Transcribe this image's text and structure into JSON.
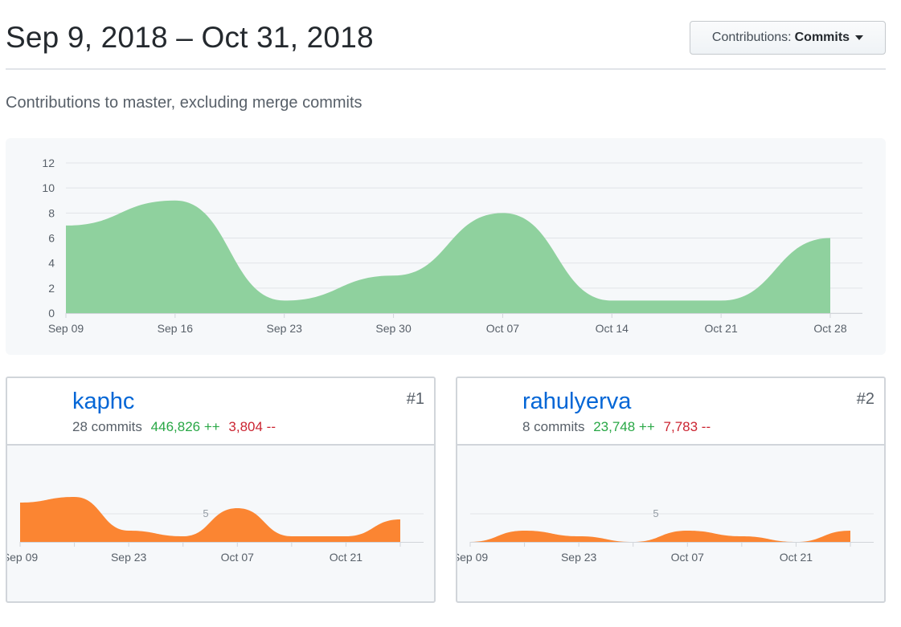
{
  "header": {
    "date_range": "Sep 9, 2018 – Oct 31, 2018",
    "dropdown_prefix": "Contributions:",
    "dropdown_value": "Commits"
  },
  "subtitle": "Contributions to master, excluding merge commits",
  "colors": {
    "main_area": "#8fd19e",
    "contributor_area": "#fb8532",
    "link": "#0366d6",
    "additions": "#28a745",
    "deletions": "#cb2431"
  },
  "chart_data": [
    {
      "type": "area",
      "title": "",
      "xlabel": "",
      "ylabel": "",
      "x_ticks": [
        "Sep 09",
        "Sep 16",
        "Sep 23",
        "Sep 30",
        "Oct 07",
        "Oct 14",
        "Oct 21",
        "Oct 28"
      ],
      "y_ticks": [
        0,
        2,
        4,
        6,
        8,
        10,
        12
      ],
      "ylim": [
        0,
        12
      ],
      "grid": true,
      "x": [
        "2018-09-09",
        "2018-09-16",
        "2018-09-23",
        "2018-09-30",
        "2018-10-07",
        "2018-10-14",
        "2018-10-21",
        "2018-10-28"
      ],
      "series": [
        {
          "values": [
            7,
            9,
            1,
            3,
            8,
            1,
            1,
            6
          ]
        }
      ]
    },
    {
      "type": "area",
      "contributor": "kaphc",
      "x_ticks": [
        "Sep 09",
        "Sep 23",
        "Oct 07",
        "Oct 21"
      ],
      "y_ticks": [
        5
      ],
      "ylim": [
        0,
        9
      ],
      "x": [
        "2018-09-09",
        "2018-09-16",
        "2018-09-23",
        "2018-09-30",
        "2018-10-07",
        "2018-10-14",
        "2018-10-21",
        "2018-10-28"
      ],
      "series": [
        {
          "values": [
            7,
            8,
            2,
            1,
            6,
            1,
            1,
            4
          ]
        }
      ]
    },
    {
      "type": "area",
      "contributor": "rahulyerva",
      "x_ticks": [
        "Sep 09",
        "Sep 23",
        "Oct 07",
        "Oct 21"
      ],
      "y_ticks": [
        5
      ],
      "ylim": [
        0,
        9
      ],
      "x": [
        "2018-09-09",
        "2018-09-16",
        "2018-09-23",
        "2018-09-30",
        "2018-10-07",
        "2018-10-14",
        "2018-10-21",
        "2018-10-28"
      ],
      "series": [
        {
          "values": [
            0,
            2,
            1,
            0,
            2,
            1,
            0,
            2
          ]
        }
      ]
    }
  ],
  "contributors": [
    {
      "username": "kaphc",
      "rank": "#1",
      "commits": "28 commits",
      "additions": "446,826 ++",
      "deletions": "3,804 --",
      "avatar": "photo-avatar"
    },
    {
      "username": "rahulyerva",
      "rank": "#2",
      "commits": "8 commits",
      "additions": "23,748 ++",
      "deletions": "7,783 --",
      "avatar": "identicon-avatar"
    }
  ]
}
